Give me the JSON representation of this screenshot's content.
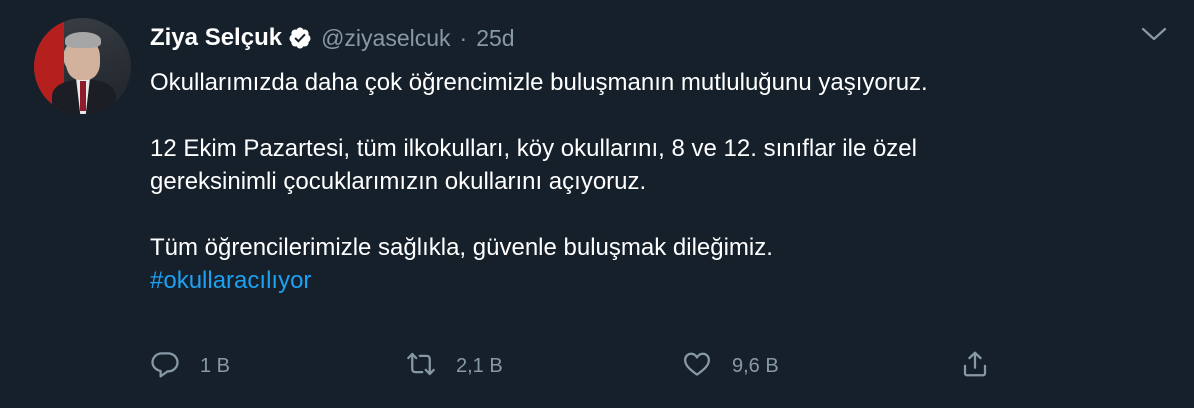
{
  "tweet": {
    "author_name": "Ziya Selçuk",
    "handle": "@ziyaselcuk",
    "separator": "·",
    "time": "25d",
    "lines": [
      "Okullarımızda daha çok öğrencimizle buluşmanın mutluluğunu yaşıyoruz.",
      "12 Ekim Pazartesi, tüm ilkokulları, köy okullarını, 8 ve 12. sınıflar ile özel",
      "gereksinimli çocuklarımızın okullarını açıyoruz.",
      "Tüm öğrencilerimizle sağlıkla, güvenle buluşmak dileğimiz."
    ],
    "hashtag": "#okullaracılıyor",
    "actions": {
      "reply_count": "1 B",
      "retweet_count": "2,1 B",
      "like_count": "9,6 B"
    }
  },
  "icons": [
    "verified-badge-icon",
    "chevron-down-icon",
    "reply-icon",
    "retweet-icon",
    "like-icon",
    "share-icon"
  ],
  "colors": {
    "background": "#15202b",
    "text": "#ffffff",
    "secondary": "#8899a6",
    "accent": "#1da1f2"
  }
}
